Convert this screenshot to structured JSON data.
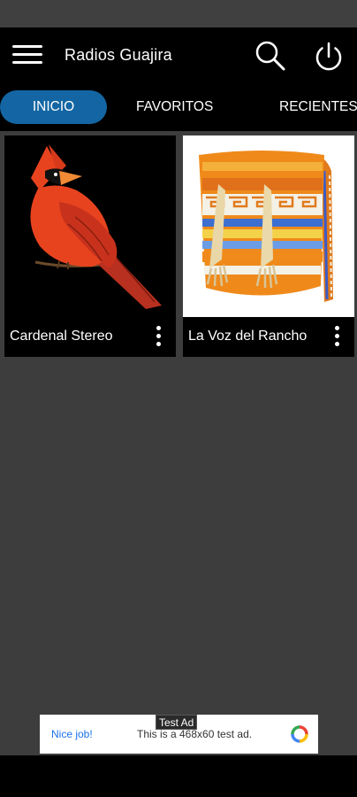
{
  "app_bar": {
    "title": "Radios Guajira",
    "menu_icon": "hamburger-menu-icon",
    "search_icon": "search-icon",
    "power_icon": "power-icon"
  },
  "tabs": [
    {
      "label": "INICIO",
      "active": true
    },
    {
      "label": "FAVORITOS",
      "active": false
    },
    {
      "label": "RECIENTES",
      "active": false
    }
  ],
  "stations": [
    {
      "name": "Cardenal Stereo",
      "image": "red-cardinal-bird"
    },
    {
      "name": "La Voz del Rancho",
      "image": "wayuu-woven-bag"
    }
  ],
  "ad": {
    "label": "Test Ad",
    "headline": "Nice job!",
    "description": "This is a 468x60 test ad."
  },
  "colors": {
    "accent": "#1366a3",
    "background": "#3d3d3d",
    "bar": "#000000"
  }
}
